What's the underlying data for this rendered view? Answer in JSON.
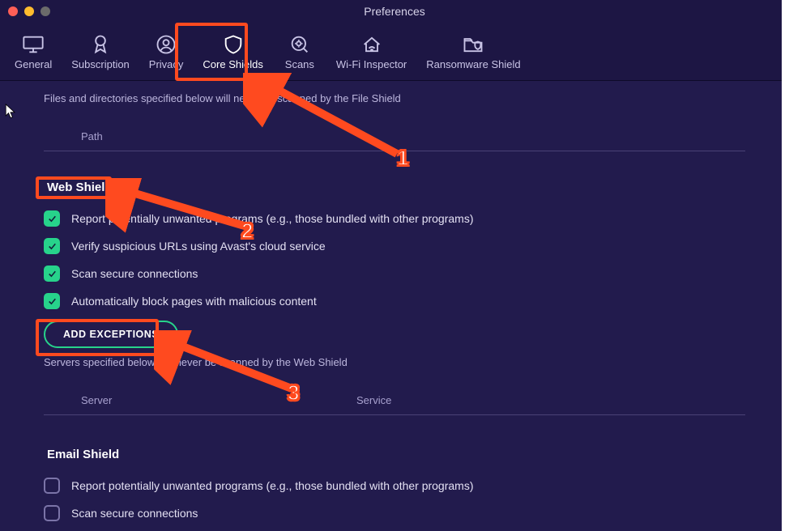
{
  "window": {
    "title": "Preferences"
  },
  "tabs": [
    {
      "label": "General"
    },
    {
      "label": "Subscription"
    },
    {
      "label": "Privacy"
    },
    {
      "label": "Core Shields"
    },
    {
      "label": "Scans"
    },
    {
      "label": "Wi-Fi Inspector"
    },
    {
      "label": "Ransomware Shield"
    }
  ],
  "fileShield": {
    "description": "Files and directories specified below will never be scanned by the File Shield",
    "columns": {
      "path": "Path"
    }
  },
  "webShield": {
    "title": "Web Shield",
    "options": {
      "pup": "Report potentially unwanted programs (e.g., those bundled with other programs)",
      "verifyUrls": "Verify suspicious URLs using Avast's cloud service",
      "scanSecure": "Scan secure connections",
      "autoBlock": "Automatically block pages with malicious content"
    },
    "addExceptions": "ADD EXCEPTIONS",
    "description": "Servers specified below will never be scanned by the Web Shield",
    "columns": {
      "server": "Server",
      "service": "Service"
    }
  },
  "emailShield": {
    "title": "Email Shield",
    "options": {
      "pup": "Report potentially unwanted programs (e.g., those bundled with other programs)",
      "scanSecure": "Scan secure connections"
    }
  },
  "annotations": {
    "n1": "1",
    "n2": "2",
    "n3": "3"
  }
}
